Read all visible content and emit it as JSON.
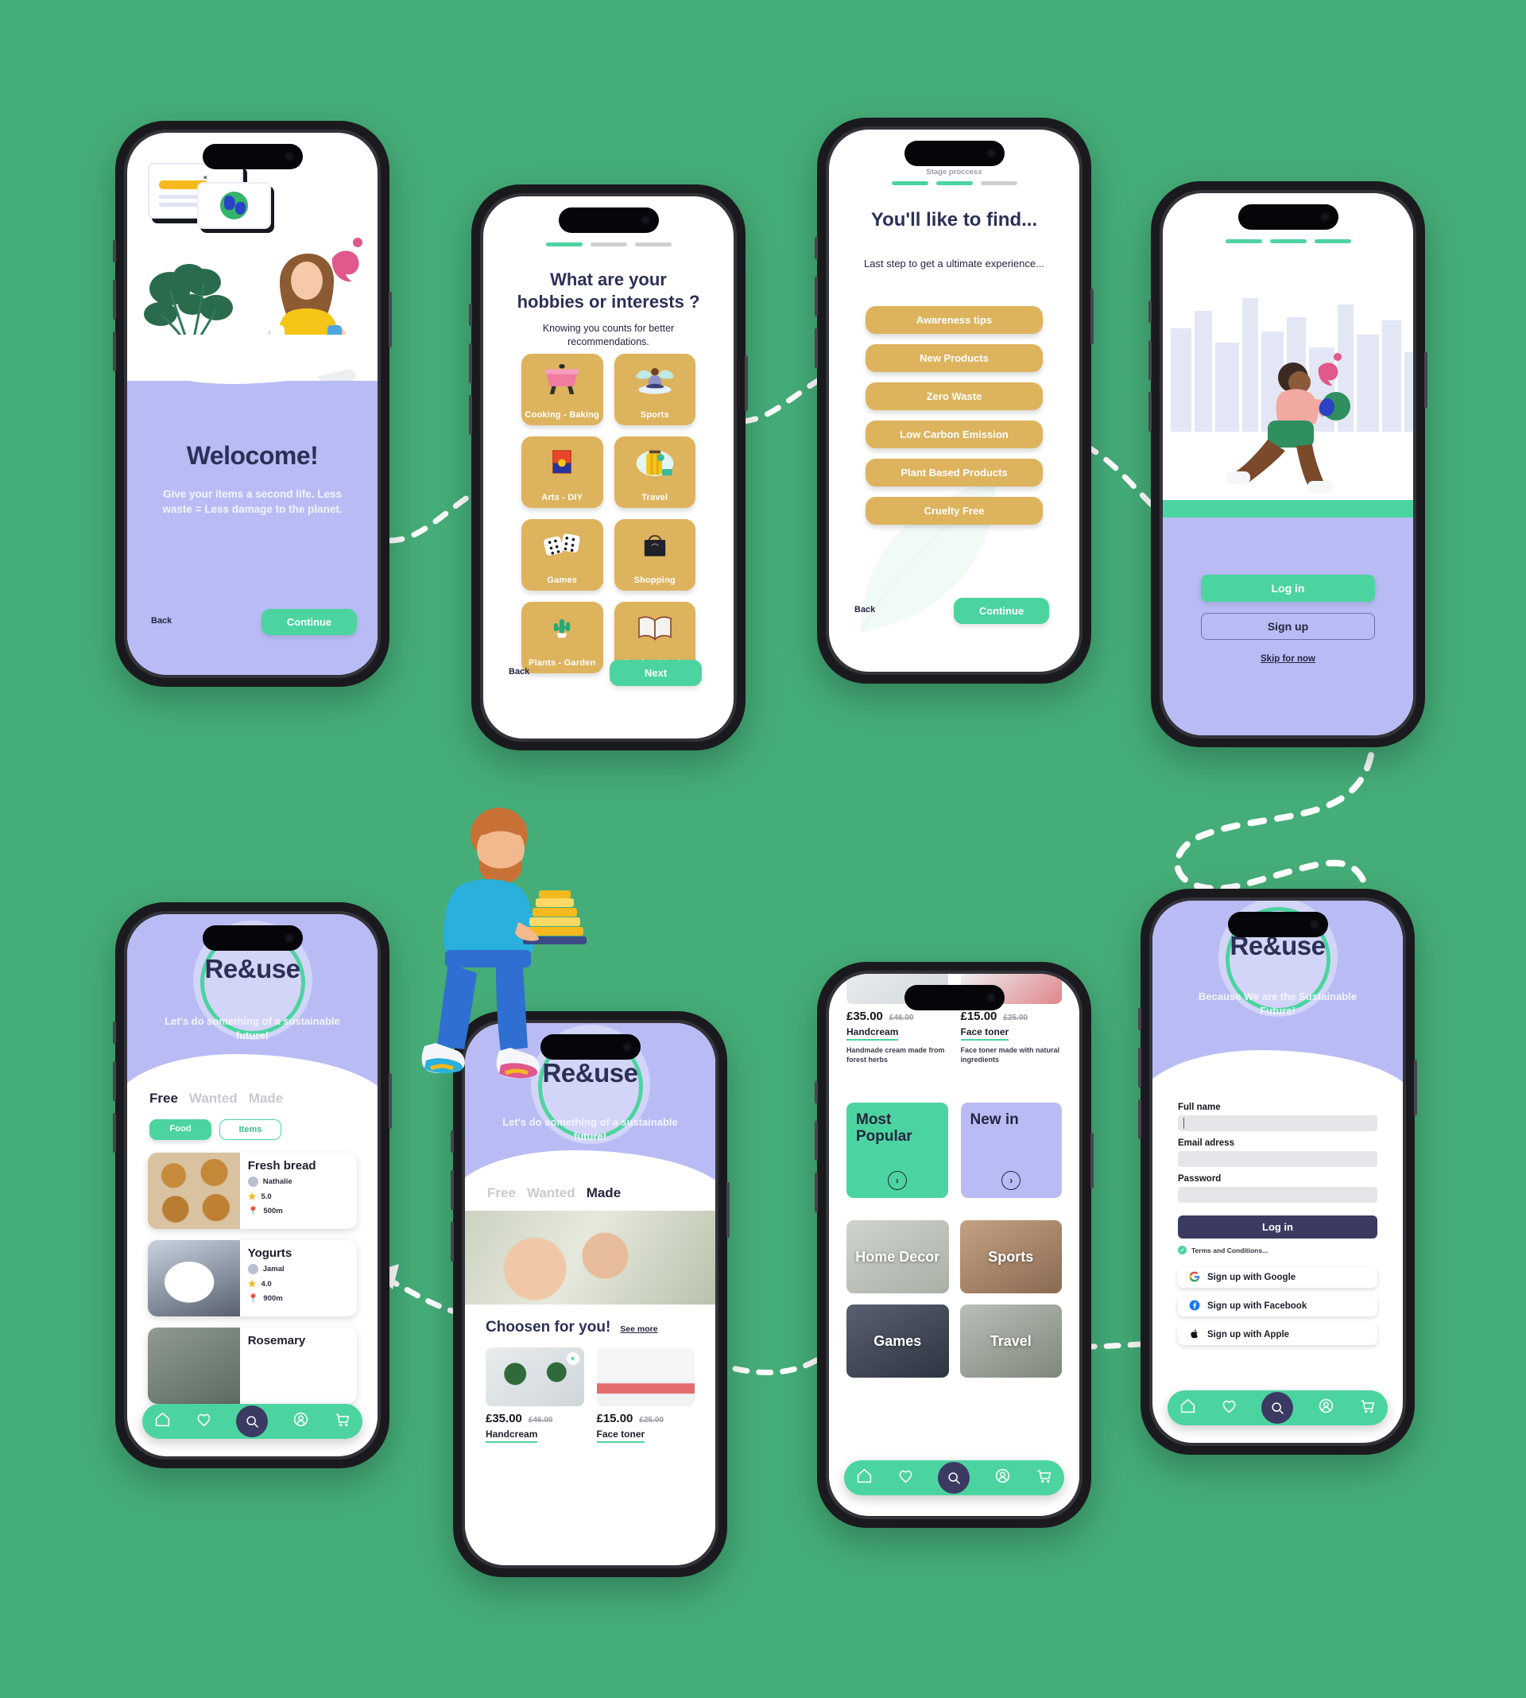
{
  "theme": {
    "bg_green": "#45ad78",
    "accent_green": "#4cd4a0",
    "lavender": "#b9bcf4",
    "navy": "#2c3056",
    "gold": "#ddb35d"
  },
  "screen1": {
    "name": "welcome",
    "title": "Welocome!",
    "subtitle": "Give your items a second life. Less waste = Less damage to the planet.",
    "back_label": "Back",
    "primary_label": "Continue"
  },
  "screen2": {
    "name": "hobbies",
    "title_line1": "What are your",
    "title_line2": "hobbies or interests ?",
    "subtitle": "Knowing you counts for better recommendations.",
    "stage_active": 1,
    "stage_total": 3,
    "tiles": [
      {
        "label": "Cooking - Baking",
        "icon": "pot-icon"
      },
      {
        "label": "Sports",
        "icon": "yoga-icon"
      },
      {
        "label": "Arts - DIY",
        "icon": "painting-icon"
      },
      {
        "label": "Travel",
        "icon": "luggage-icon"
      },
      {
        "label": "Games",
        "icon": "dice-icon"
      },
      {
        "label": "Shopping",
        "icon": "tote-bag-icon"
      },
      {
        "label": "Plants - Garden",
        "icon": "cactus-icon"
      },
      {
        "label": "Books - Music",
        "icon": "open-book-icon"
      }
    ],
    "back_label": "Back",
    "primary_label": "Next"
  },
  "screen3": {
    "name": "interests",
    "stage_caption": "Stage proccess",
    "stage_active": 2,
    "stage_total": 3,
    "title": "You'll like to find...",
    "subtitle": "Last step to get a ultimate experience...",
    "chips": [
      "Awareness tips",
      "New Products",
      "Zero Waste",
      "Low Carbon Emission",
      "Plant Based Products",
      "Cruelty Free"
    ],
    "back_label": "Back",
    "primary_label": "Continue"
  },
  "screen4": {
    "name": "auth-choice",
    "stage_active": 3,
    "stage_total": 3,
    "login_label": "Log in",
    "signup_label": "Sign up",
    "skip_label": "Skip for now"
  },
  "screen5": {
    "name": "free-food-feed",
    "logo": "Re&use",
    "tagline": "Let's do something of a sustainable future!",
    "tabs": [
      {
        "label": "Free",
        "active": true
      },
      {
        "label": "Wanted",
        "active": false
      },
      {
        "label": "Made",
        "active": false
      }
    ],
    "segments": [
      {
        "label": "Food",
        "selected": true
      },
      {
        "label": "Items",
        "selected": false
      }
    ],
    "listings": [
      {
        "title": "Fresh bread",
        "user": "Nathalie",
        "rating": "5.0",
        "distance": "500m"
      },
      {
        "title": "Yogurts",
        "user": "Jamal",
        "rating": "4.0",
        "distance": "900m"
      },
      {
        "title": "Rosemary",
        "user": "",
        "rating": "",
        "distance": ""
      }
    ],
    "nav": [
      "home-icon",
      "heart-icon",
      "search-icon",
      "person-icon",
      "cart-icon"
    ]
  },
  "screen6": {
    "name": "made-feed",
    "logo": "Re&use",
    "tagline": "Let's do something of a sustainable future!",
    "tabs": [
      {
        "label": "Free",
        "active": false
      },
      {
        "label": "Wanted",
        "active": false
      },
      {
        "label": "Made",
        "active": true
      }
    ],
    "section_title": "Choosen for you!",
    "see_more": "See more",
    "products": [
      {
        "price": "£35.00",
        "old_price": "£46.00",
        "name": "Handcream"
      },
      {
        "price": "£15.00",
        "old_price": "£25.00",
        "name": "Face toner"
      }
    ]
  },
  "screen7": {
    "name": "categories",
    "products": [
      {
        "price": "£35.00",
        "old_price": "£46.00",
        "name": "Handcream",
        "desc": "Handmade cream made from forest herbs"
      },
      {
        "price": "£15.00",
        "old_price": "£25.00",
        "name": "Face toner",
        "desc": "Face toner made with natural ingredients"
      }
    ],
    "feature_tiles": [
      {
        "label": "Most Popular",
        "color": "#4cd4a0"
      },
      {
        "label": "New in",
        "color": "#b9bcf4"
      }
    ],
    "category_tiles": [
      "Home Decor",
      "Sports",
      "Games",
      "Travel"
    ],
    "nav": [
      "home-icon",
      "heart-icon",
      "search-icon",
      "person-icon",
      "cart-icon"
    ]
  },
  "screen8": {
    "name": "signup",
    "logo": "Re&use",
    "tagline": "Because We are the Sustainable Future!",
    "fields": [
      {
        "label": "Full name",
        "value": "",
        "focused": true
      },
      {
        "label": "Email adress",
        "value": "",
        "focused": false
      },
      {
        "label": "Password",
        "value": "",
        "focused": false
      }
    ],
    "submit_label": "Log in",
    "terms_label": "Terms and Conditions...",
    "social": [
      {
        "label": "Sign up with Google",
        "icon": "google-icon"
      },
      {
        "label": "Sign up with Facebook",
        "icon": "facebook-icon"
      },
      {
        "label": "Sign up with Apple",
        "icon": "apple-icon"
      }
    ],
    "nav": [
      "home-icon",
      "heart-icon",
      "search-icon",
      "person-icon",
      "cart-icon"
    ]
  }
}
